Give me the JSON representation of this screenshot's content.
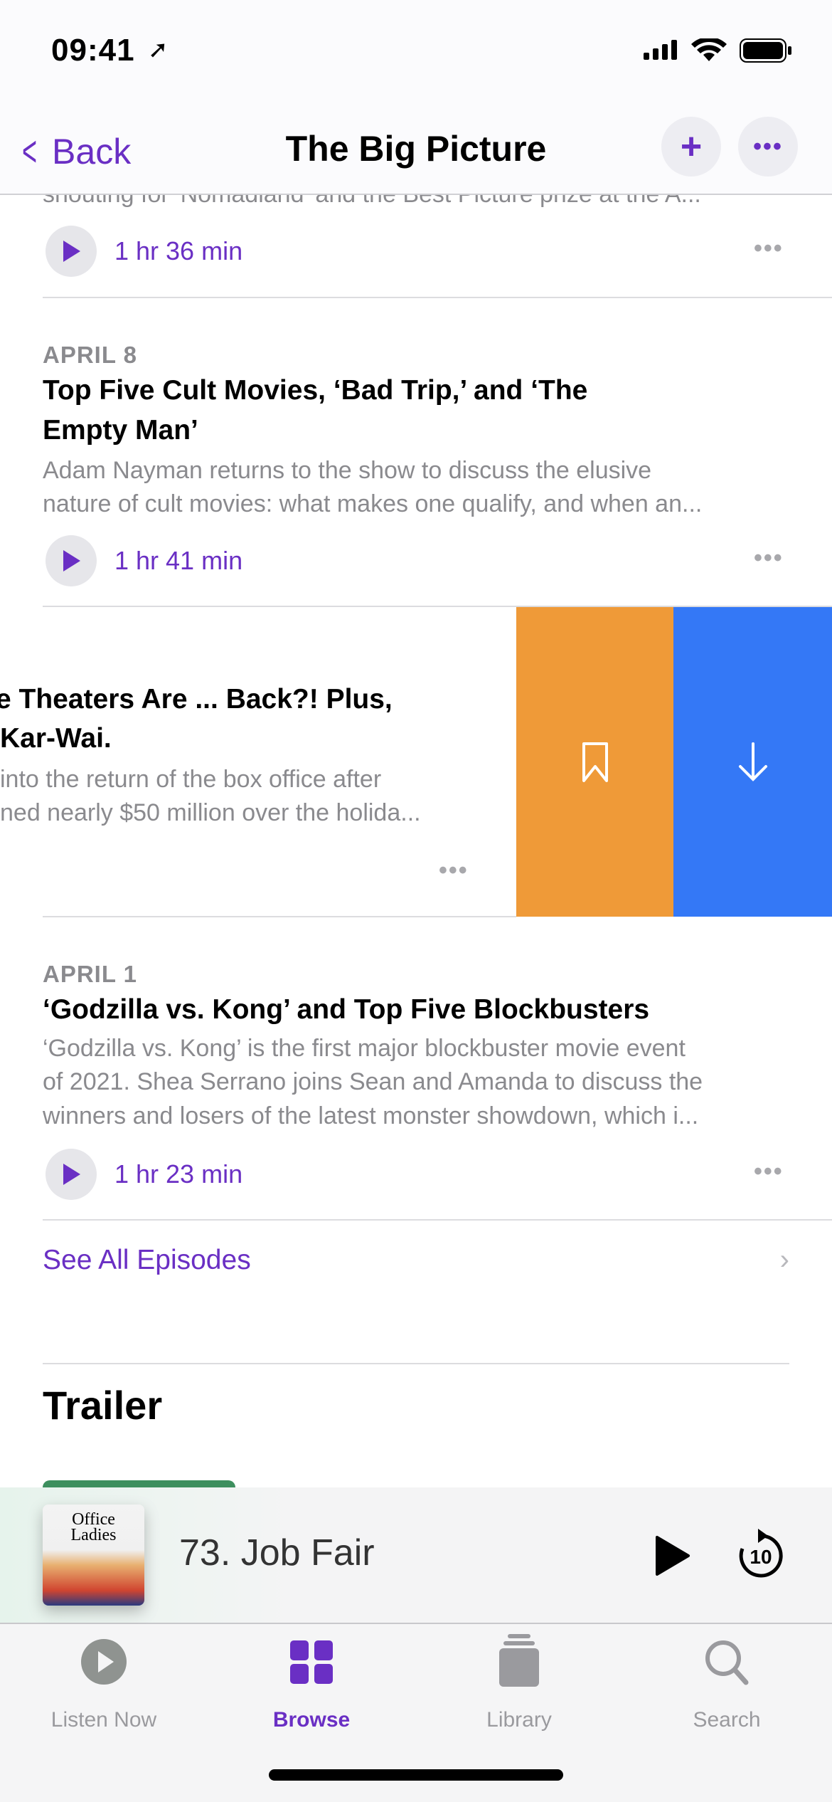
{
  "status": {
    "time": "09:41"
  },
  "nav": {
    "back": "Back",
    "title": "The Big Picture"
  },
  "episodes": [
    {
      "desc_tail": "shouting for 'Nomadland' and the Best Picture prize at the A...",
      "duration": "1 hr 36 min"
    },
    {
      "date": "APRIL 8",
      "title1": "Top Five Cult Movies, ‘Bad Trip,’ and ‘The",
      "title2": "Empty Man’",
      "desc1": "Adam Nayman returns to the show to discuss the elusive",
      "desc2": "nature of cult movies: what makes one qualify, and when an...",
      "duration": "1 hr 41 min"
    },
    {
      "title1": "e Theaters Are ... Back?! Plus,",
      "title2": "Kar-Wai.",
      "desc1": " into the return of the box office after",
      "desc2": "ned nearly $50 million over the holida..."
    },
    {
      "date": "APRIL 1",
      "title1": "‘Godzilla vs. Kong’ and Top Five Blockbusters",
      "desc1": "‘Godzilla vs. Kong’ is the first major blockbuster movie event",
      "desc2": "of 2021. Shea Serrano joins Sean and Amanda to discuss the",
      "desc3": "winners and losers of the latest monster showdown, which i...",
      "duration": "1 hr 23 min"
    }
  ],
  "swipe_actions": {
    "save_color": "#ef9a38",
    "download_color": "#3478f6"
  },
  "see_all": "See All Episodes",
  "trailer_heading": "Trailer",
  "mini_player": {
    "artwork_title": "Office Ladies",
    "episode": "73. Job Fair",
    "skip": "10"
  },
  "tabs": [
    {
      "label": "Listen Now"
    },
    {
      "label": "Browse",
      "active": true
    },
    {
      "label": "Library"
    },
    {
      "label": "Search"
    }
  ],
  "accent": "#6a2fc4"
}
